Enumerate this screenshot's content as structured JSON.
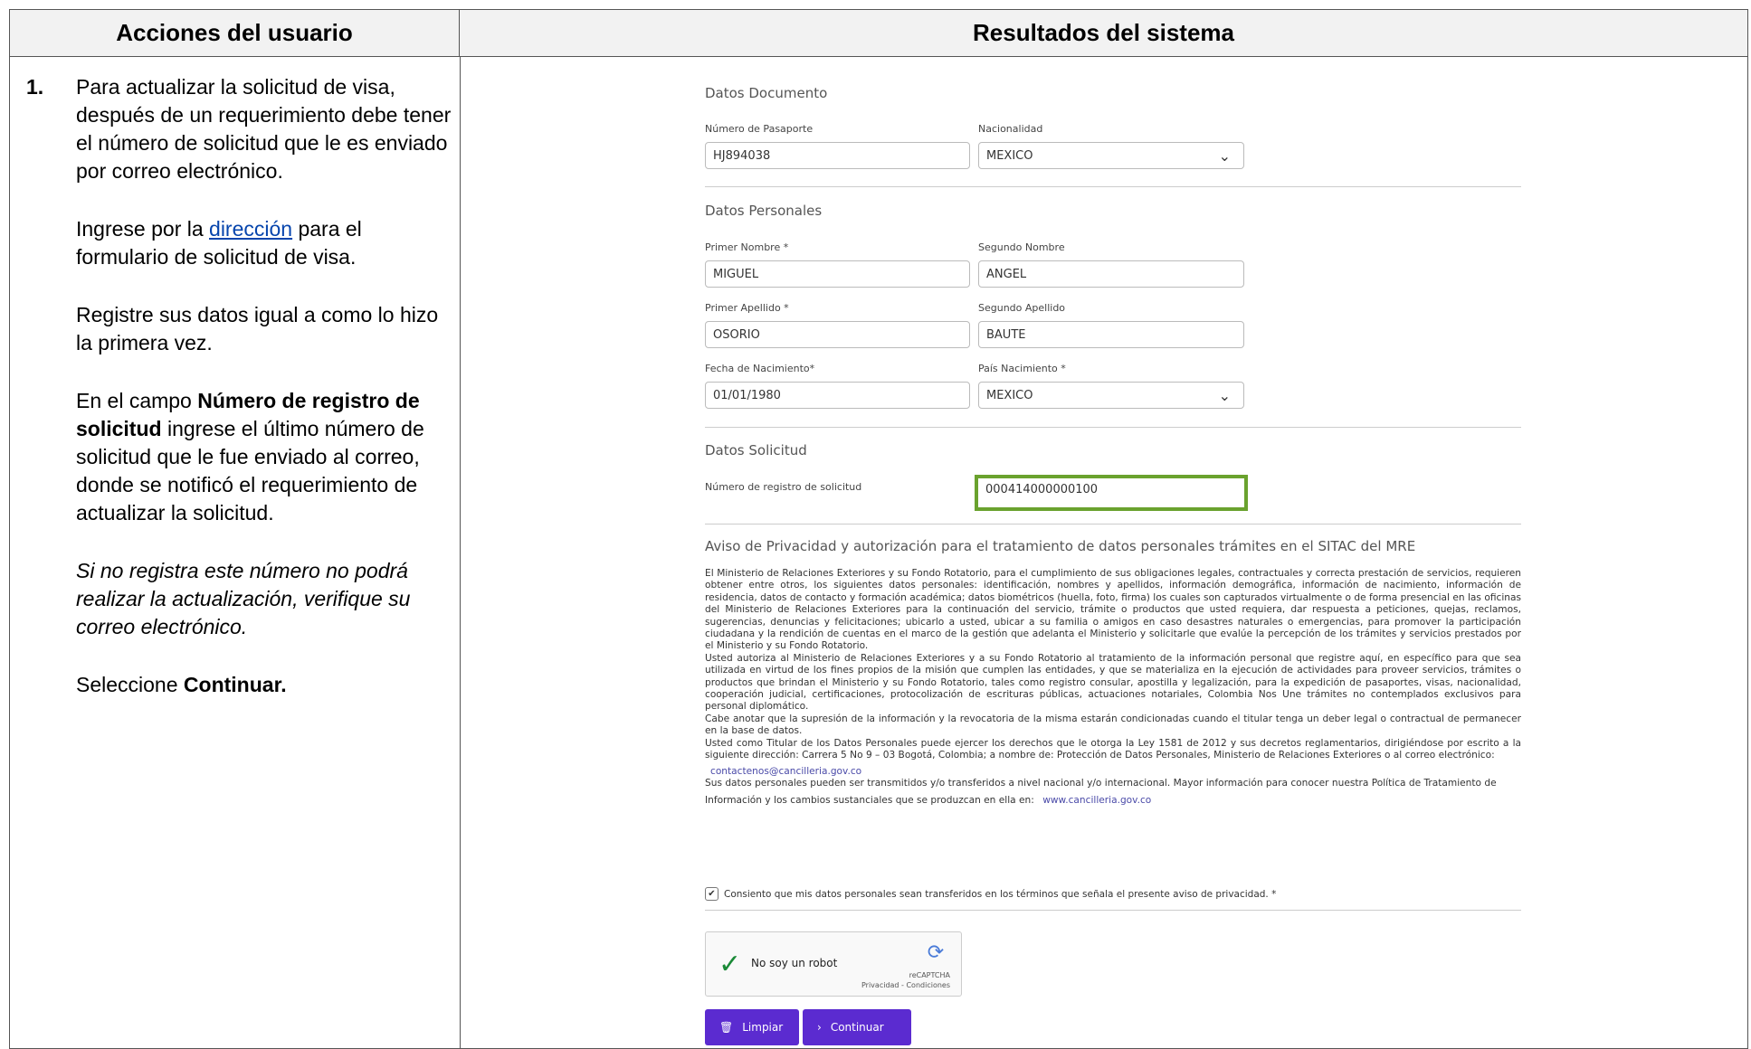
{
  "headers": {
    "left": "Acciones del usuario",
    "right": "Resultados del sistema"
  },
  "step": {
    "number": "1.",
    "p1": "Para actualizar la solicitud de visa, después de un requerimiento debe tener el número de solicitud que le es enviado por correo electrónico.",
    "p2_pre": "Ingrese por la ",
    "p2_link": "dirección",
    "p2_post": " para el formulario de solicitud de visa.",
    "p3": "Registre sus datos igual a como lo hizo la primera vez.",
    "p4_pre": "En el campo ",
    "p4_bold": "Número de registro de solicitud",
    "p4_post": " ingrese el último número de solicitud que le fue enviado al correo, donde se notificó el requerimiento de actualizar la solicitud.",
    "p5": "Si no registra este número no podrá realizar la actualización, verifique su correo electrónico.",
    "p6_pre": "Seleccione ",
    "p6_bold": "Continuar."
  },
  "form": {
    "doc_section": "Datos Documento",
    "passport_label": "Número de Pasaporte",
    "passport_value": "HJ894038",
    "nationality_label": "Nacionalidad",
    "nationality_value": "MEXICO",
    "personal_section": "Datos Personales",
    "first_name_label": "Primer Nombre *",
    "first_name_value": "MIGUEL",
    "second_name_label": "Segundo Nombre",
    "second_name_value": "ANGEL",
    "first_surname_label": "Primer Apellido *",
    "first_surname_value": "OSORIO",
    "second_surname_label": "Segundo Apellido",
    "second_surname_value": "BAUTE",
    "birth_label": "Fecha de Nacimiento*",
    "birth_value": "01/01/1980",
    "birth_country_label": "País Nacimiento *",
    "birth_country_value": "MEXICO",
    "request_section": "Datos Solicitud",
    "request_label": "Número de registro de solicitud",
    "request_value": "000414000000100",
    "privacy_title": "Aviso de Privacidad y autorización para el tratamiento de datos personales trámites en el SITAC del MRE",
    "privacy_p1": "El Ministerio de Relaciones Exteriores y su Fondo Rotatorio, para el cumplimiento de sus obligaciones legales, contractuales y correcta prestación de servicios, requieren obtener entre otros, los siguientes datos personales: identificación, nombres y apellidos, información demográfica, información de nacimiento, información de residencia, datos de contacto y formación académica; datos biométricos (huella, foto, firma) los cuales son capturados virtualmente o de forma presencial en las oficinas del Ministerio de Relaciones Exteriores para la continuación del servicio, trámite o productos que usted requiera, dar respuesta a peticiones, quejas, reclamos, sugerencias, denuncias y felicitaciones; ubicarlo a usted, ubicar a su familia o amigos en caso desastres naturales o emergencias, para promover la participación ciudadana y la rendición de cuentas en el marco de la gestión que adelanta el Ministerio y solicitarle que evalúe la percepción de los trámites y servicios prestados por el Ministerio y su Fondo Rotatorio.",
    "privacy_p2": "Usted autoriza al Ministerio de Relaciones Exteriores y a su Fondo Rotatorio al tratamiento de la información personal que registre aquí, en específico para que sea utilizada en virtud de los fines propios de la misión que cumplen las entidades, y que se materializa en la ejecución de actividades para proveer servicios, trámites o productos que brindan el Ministerio y su Fondo Rotatorio, tales como registro consular, apostilla y legalización, para la expedición de pasaportes, visas, nacionalidad, cooperación judicial, certificaciones, protocolización de escrituras públicas, actuaciones notariales, Colombia Nos Une trámites no contemplados exclusivos para personal diplomático.",
    "privacy_p3": "Cabe anotar que la supresión de la información y la revocatoria de la misma estarán condicionadas cuando el titular tenga un deber legal o contractual de permanecer en la base de datos.",
    "privacy_p4": "Usted como Titular de los Datos Personales puede ejercer los derechos que le otorga la Ley 1581 de 2012 y sus decretos reglamentarios, dirigiéndose por escrito a la siguiente dirección: Carrera 5 No 9 – 03 Bogotá, Colombia; a nombre de: Protección de Datos Personales, Ministerio de Relaciones Exteriores o al correo electrónico:",
    "privacy_email": "contactenos@cancilleria.gov.co",
    "privacy_p5": "Sus datos personales pueden ser transmitidos y/o transferidos a nivel nacional y/o internacional. Mayor información para conocer nuestra Política de Tratamiento de",
    "privacy_p6": "Información y los cambios sustanciales que se produzcan en ella en:",
    "privacy_url": "www.cancilleria.gov.co",
    "consent": "Consiento que mis datos personales sean transferidos en los términos que señala el presente aviso de privacidad. *",
    "captcha_text": "No soy un robot",
    "captcha_brand": "reCAPTCHA",
    "captcha_links": "Privacidad - Condiciones",
    "btn_clear": "Limpiar",
    "btn_continue": "Continuar"
  }
}
